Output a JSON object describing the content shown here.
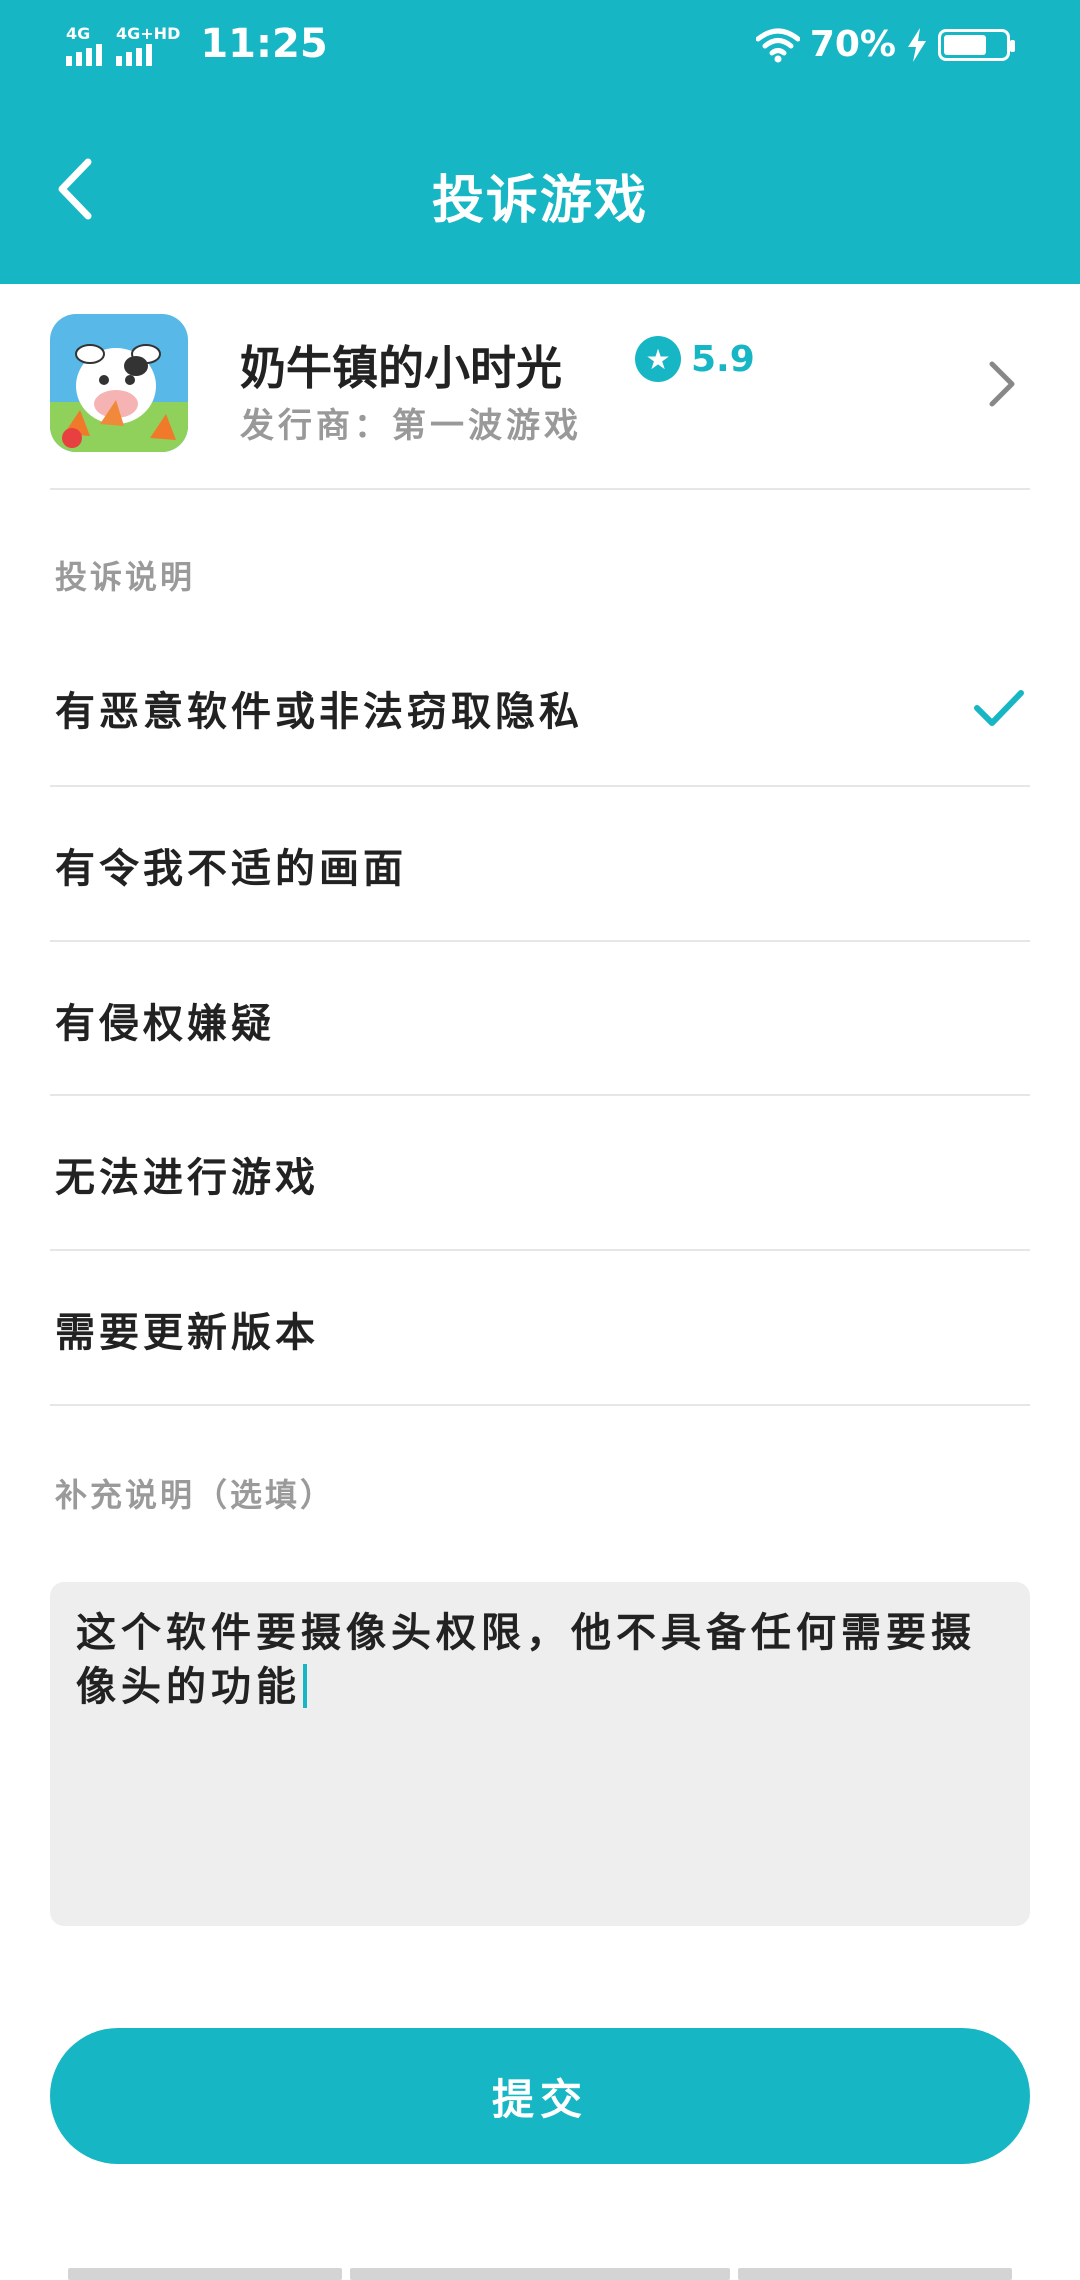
{
  "status_bar": {
    "sim1_label": "4G",
    "sim2_label": "4G+HD",
    "time": "11:25",
    "battery_percent_text": "70%",
    "battery_level": 0.7,
    "icons": [
      "signal-icon",
      "wifi-icon",
      "charging-icon",
      "battery-icon"
    ]
  },
  "header": {
    "title": "投诉游戏",
    "back_icon": "chevron-left-icon"
  },
  "game": {
    "name": "奶牛镇的小时光",
    "rating": "5.9",
    "publisher_label": "发行商：",
    "publisher_name": "第一波游戏"
  },
  "complaint": {
    "section_label": "投诉说明",
    "options": [
      {
        "label": "有恶意软件或非法窃取隐私",
        "selected": true
      },
      {
        "label": "有令我不适的画面",
        "selected": false
      },
      {
        "label": "有侵权嫌疑",
        "selected": false
      },
      {
        "label": "无法进行游戏",
        "selected": false
      },
      {
        "label": "需要更新版本",
        "selected": false
      }
    ]
  },
  "supplement": {
    "section_label": "补充说明（选填）",
    "value": "这个软件要摄像头权限，他不具备任何需要摄像头的功能"
  },
  "submit_label": "提交",
  "colors": {
    "accent": "#16b6c4",
    "divider": "#e6e6e6",
    "textarea_bg": "#eeeeee"
  }
}
